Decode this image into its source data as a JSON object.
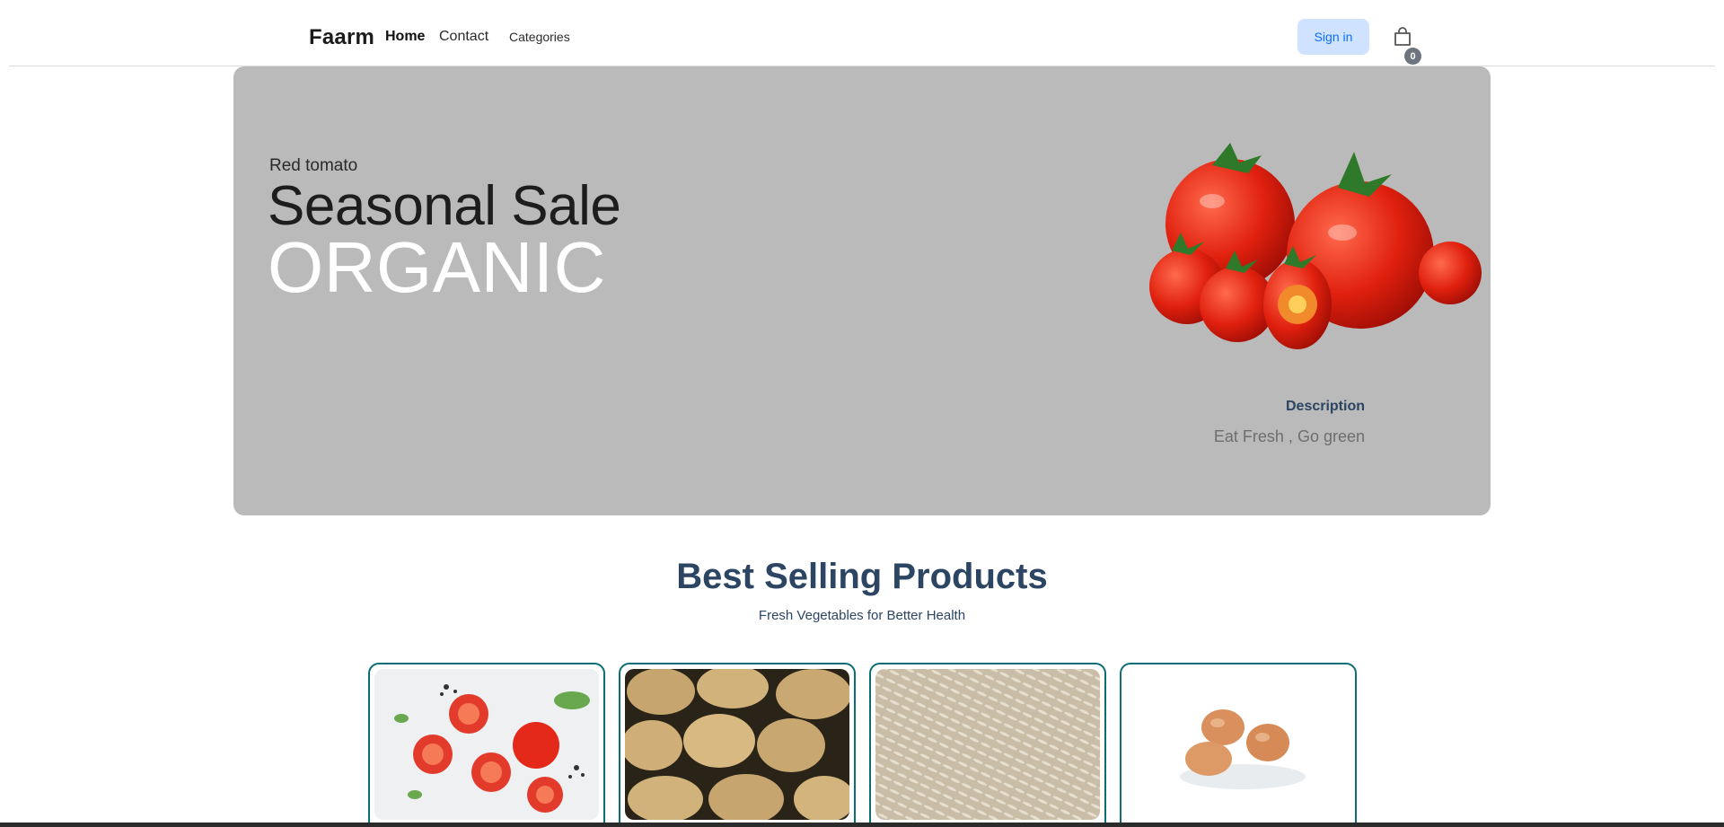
{
  "navbar": {
    "brand": "Faarm",
    "links": [
      {
        "label": "Home"
      },
      {
        "label": "Contact"
      },
      {
        "label": "Categories"
      }
    ],
    "signin_label": "Sign in",
    "cart_icon": "shopping-bag-icon",
    "cart_count": "0"
  },
  "hero": {
    "kicker": "Red tomato",
    "title": "Seasonal Sale",
    "subtitle": "ORGANIC",
    "image": "tomatoes-image",
    "description_label": "Description",
    "description_text": "Eat Fresh , Go green",
    "background_color": "#bababa"
  },
  "section": {
    "title": "Best Selling Products",
    "subtitle": "Fresh Vegetables for Better Health"
  },
  "products": [
    {
      "image": "tomatoes-image"
    },
    {
      "image": "potatoes-image"
    },
    {
      "image": "rice-image"
    },
    {
      "image": "eggs-image"
    }
  ],
  "colors": {
    "accent": "#2c4563",
    "card_border": "#0b6e74",
    "signin_bg": "#cfe2ff",
    "signin_text": "#0d6efd"
  }
}
